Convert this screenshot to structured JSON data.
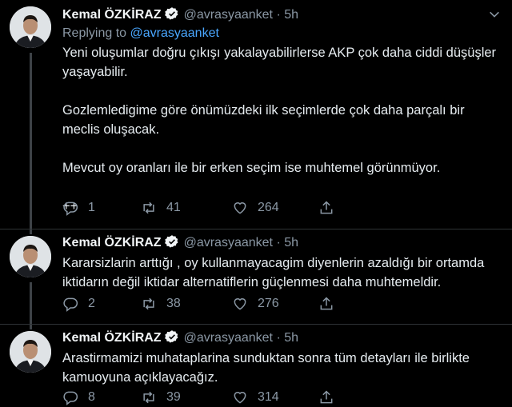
{
  "tweets": [
    {
      "name": "Kemal ÖZKİRAZ",
      "handle": "@avrasyaanket",
      "dot": "·",
      "time": "5h",
      "replying_label": "Replying to",
      "replying_to": "@avrasyaanket",
      "paragraphs": [
        "Yeni oluşumlar doğru çıkışı yakalayabilirlerse AKP çok daha ciddi düşüşler yaşayabilir.",
        "Gozlemledigime göre önümüzdeki ilk seçimlerde çok daha parçalı bir meclis oluşacak.",
        "Mevcut oy oranları ile bir erken seçim ise muhtemel görünmüyor.",
        "++"
      ],
      "replies": "1",
      "retweets": "41",
      "likes": "264"
    },
    {
      "name": "Kemal ÖZKİRAZ",
      "handle": "@avrasyaanket",
      "dot": "·",
      "time": "5h",
      "paragraphs": [
        "Kararsizlarin arttığı , oy kullanmayacagim diyenlerin azaldığı bir ortamda iktidarın değil iktidar alternatiflerin güçlenmesi daha muhtemeldir."
      ],
      "replies": "2",
      "retweets": "38",
      "likes": "276"
    },
    {
      "name": "Kemal ÖZKİRAZ",
      "handle": "@avrasyaanket",
      "dot": "·",
      "time": "5h",
      "paragraphs": [
        "Arastirmamizi muhataplarina sunduktan sonra tüm detayları ile birlikte kamuoyuna açıklayacağız."
      ],
      "replies": "8",
      "retweets": "39",
      "likes": "314"
    }
  ],
  "icons": {
    "verified": "verified-badge-icon",
    "caret": "chevron-down-icon",
    "reply": "reply-icon",
    "retweet": "retweet-icon",
    "like": "heart-icon",
    "share": "share-icon"
  },
  "colors": {
    "background": "#000000",
    "link": "#4aa7ff",
    "muted": "#8b98a5",
    "separator": "#2f3336"
  }
}
